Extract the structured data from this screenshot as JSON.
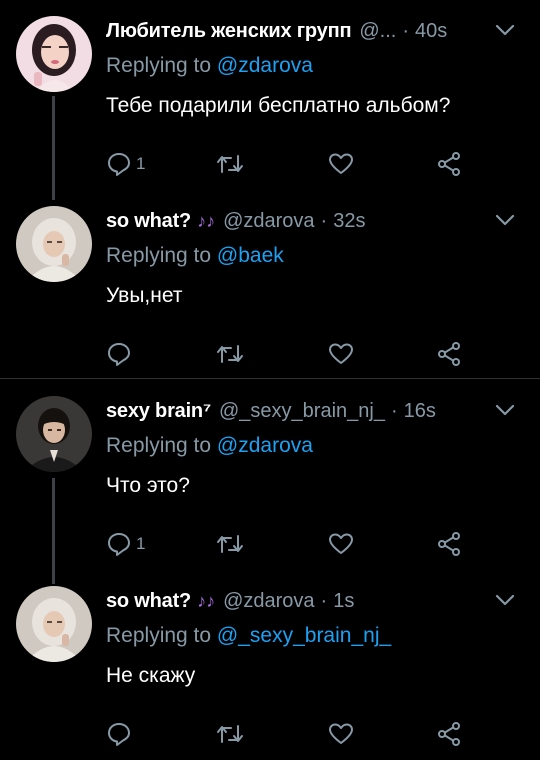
{
  "colors": {
    "background": "#000000",
    "name": "#ffffff",
    "muted": "#8899a6",
    "mention": "#1da1f2",
    "thread_line": "#3d4248",
    "divider": "#2f3336",
    "notes_emoji": "#a26bd6"
  },
  "tweets": [
    {
      "name": "Любитель женских групп",
      "handle": "@...",
      "separator": "·",
      "time": "40s",
      "replying_prefix": "Replying to ",
      "replying_to": "@zdarova",
      "text": "Тебе подарили бесплатно альбом?",
      "reply_count": "1",
      "avatar": "avatar-girl-pink"
    },
    {
      "name": "so what?",
      "emoji": "♪♪",
      "handle": "@zdarova",
      "separator": "·",
      "time": "32s",
      "replying_prefix": "Replying to ",
      "replying_to": "@baek",
      "text": "Увы,нет",
      "reply_count": "",
      "avatar": "avatar-hooded-person"
    },
    {
      "name": "sexy brain⁷",
      "handle": "@_sexy_brain_nj_",
      "separator": "·",
      "time": "16s",
      "replying_prefix": "Replying to ",
      "replying_to": "@zdarova",
      "text": "Что это?",
      "reply_count": "1",
      "avatar": "avatar-dark-hair-man"
    },
    {
      "name": "so what?",
      "emoji": "♪♪",
      "handle": "@zdarova",
      "separator": "·",
      "time": "1s",
      "replying_prefix": "Replying to ",
      "replying_to": "@_sexy_brain_nj_",
      "text": "Не скажу",
      "reply_count": "",
      "avatar": "avatar-hooded-person"
    }
  ],
  "icons": {
    "reply": "reply-icon",
    "retweet": "retweet-icon",
    "like": "heart-icon",
    "share": "share-icon",
    "more": "chevron-down-icon"
  }
}
